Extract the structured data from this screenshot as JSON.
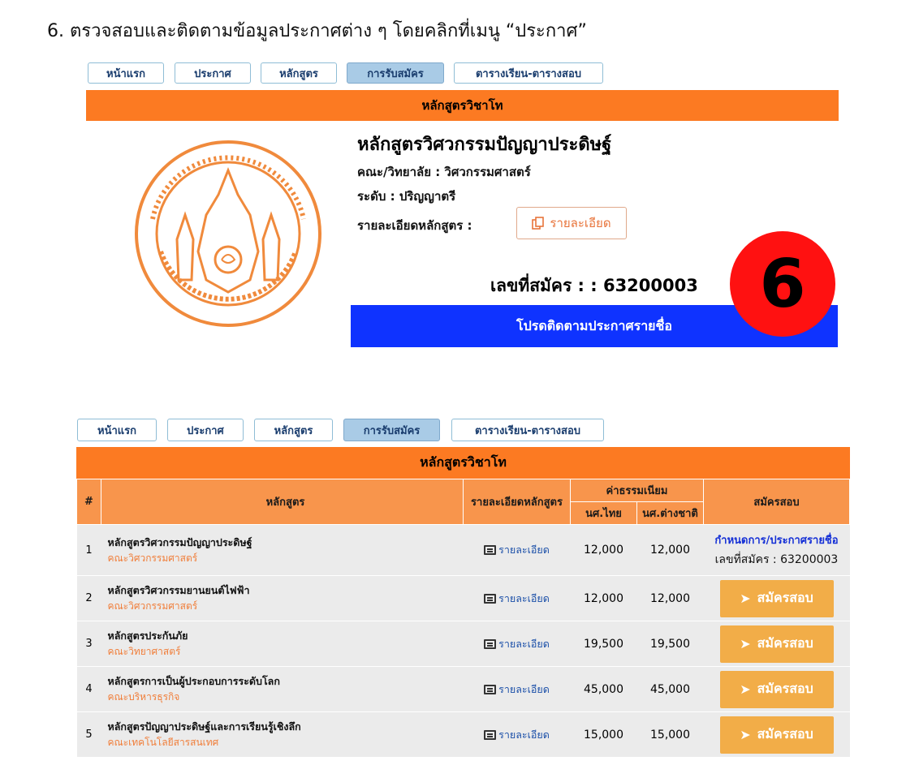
{
  "heading": "6. ตรวจสอบและติดตามข้อมูลประกาศต่าง ๆ โดยคลิกที่เมนู “ประกาศ”",
  "nav": [
    "หน้าแรก",
    "ประกาศ",
    "หลักสูตร",
    "การรับสมัคร",
    "ตารางเรียน-ตารางสอบ"
  ],
  "panel": {
    "bar_title": "หลักสูตรวิชาโท",
    "course_title": "หลักสูตรวิศวกรรมปัญญาประดิษฐ์",
    "faculty": "คณะ/วิทยาลัย : วิศวกรรมศาสตร์",
    "level": "ระดับ : ปริญญาตรี",
    "detail_label": "รายละเอียดหลักสูตร :",
    "detail_button": "รายละเอียด",
    "application_no": "เลขที่สมัคร : : 63200003",
    "follow_banner": "โปรดติดตามประกาศรายชื่อ",
    "step_badge": "6"
  },
  "table": {
    "bar_title": "หลักสูตรวิชาโท",
    "headers": {
      "num": "#",
      "course": "หลักสูตร",
      "detail": "รายละเอียดหลักสูตร",
      "fees": "ค่าธรรมเนียม",
      "fee_thai": "นศ.ไทย",
      "fee_foreign": "นศ.ต่างชาติ",
      "apply": "สมัครสอบ"
    },
    "detail_link": "รายละเอียด",
    "apply_label": "สมัครสอบ",
    "rows": [
      {
        "num": "1",
        "name": "หลักสูตรวิศวกรรมปัญญาประดิษฐ์",
        "faculty": "คณะวิศวกรรมศาสตร์",
        "thai": "12,000",
        "foreign": "12,000",
        "announce": "กำหนดการ/ประกาศรายชื่อ",
        "appno": "เลขที่สมัคร : 63200003"
      },
      {
        "num": "2",
        "name": "หลักสูตรวิศวกรรมยานยนต์ไฟฟ้า",
        "faculty": "คณะวิศวกรรมศาสตร์",
        "thai": "12,000",
        "foreign": "12,000"
      },
      {
        "num": "3",
        "name": "หลักสูตรประกันภัย",
        "faculty": "คณะวิทยาศาสตร์",
        "thai": "19,500",
        "foreign": "19,500"
      },
      {
        "num": "4",
        "name": "หลักสูตรการเป็นผู้ประกอบการระดับโลก",
        "faculty": "คณะบริหารธุรกิจ",
        "thai": "45,000",
        "foreign": "45,000"
      },
      {
        "num": "5",
        "name": "หลักสูตรปัญญาประดิษฐ์และการเรียนรู้เชิงลึก",
        "faculty": "คณะเทคโนโลยีสารสนเทศ",
        "thai": "15,000",
        "foreign": "15,000"
      }
    ]
  },
  "colors": {
    "orange": "#fc7a22",
    "blue_banner": "#0f33ff",
    "badge_red": "#ff1111",
    "apply_btn": "#f2ad48"
  }
}
